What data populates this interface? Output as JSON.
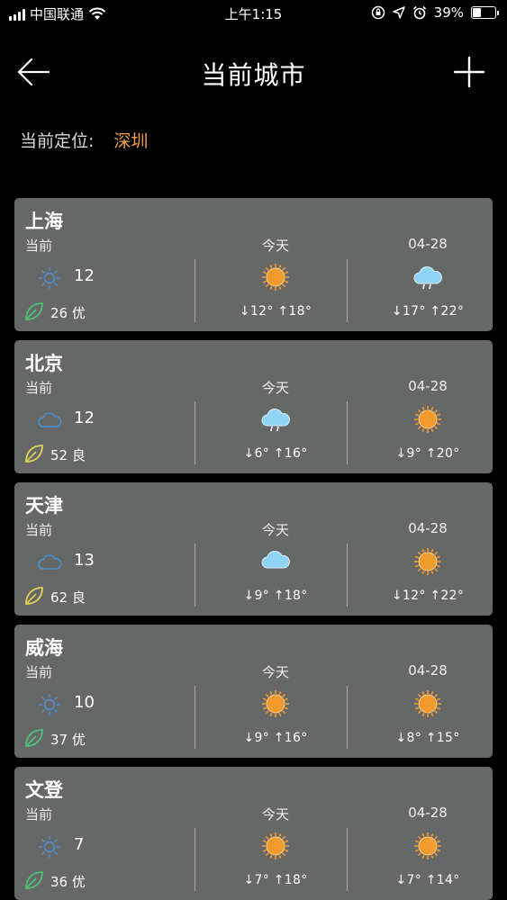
{
  "status_bar": {
    "carrier": "中国联通",
    "time": "上午1:15",
    "battery": "39%",
    "battery_level": 0.39
  },
  "nav": {
    "title": "当前城市",
    "back_icon": "back-arrow-icon",
    "add_icon": "plus-icon"
  },
  "location": {
    "label": "当前定位:",
    "value": "深圳"
  },
  "colors": {
    "background": "#000000",
    "card": "#666767",
    "accent": "#f0a24a",
    "sun": "#f39a2c",
    "cloud_light": "#8fd4f5"
  },
  "cards": [
    {
      "city": "上海",
      "current_label": "当前",
      "current_temp": "12",
      "current_icon": "sun-outline-icon",
      "aqi": "26 优",
      "aqi_color": "#4fc27a",
      "today_label": "今天",
      "today_icon": "sun-icon",
      "today_temps": "↓12° ↑18°",
      "next_label": "04-28",
      "next_icon": "cloud-rain-icon",
      "next_temps": "↓17° ↑22°"
    },
    {
      "city": "北京",
      "current_label": "当前",
      "current_temp": "12",
      "current_icon": "cloud-outline-icon",
      "aqi": "52 良",
      "aqi_color": "#e2d45a",
      "today_label": "今天",
      "today_icon": "cloud-rain-icon",
      "today_temps": "↓6° ↑16°",
      "next_label": "04-28",
      "next_icon": "sun-icon",
      "next_temps": "↓9° ↑20°"
    },
    {
      "city": "天津",
      "current_label": "当前",
      "current_temp": "13",
      "current_icon": "cloud-outline-icon",
      "aqi": "62 良",
      "aqi_color": "#e2d45a",
      "today_label": "今天",
      "today_icon": "cloud-icon",
      "today_temps": "↓9° ↑18°",
      "next_label": "04-28",
      "next_icon": "sun-icon",
      "next_temps": "↓12° ↑22°"
    },
    {
      "city": "威海",
      "current_label": "当前",
      "current_temp": "10",
      "current_icon": "sun-outline-icon",
      "aqi": "37 优",
      "aqi_color": "#4fc27a",
      "today_label": "今天",
      "today_icon": "sun-icon",
      "today_temps": "↓9° ↑16°",
      "next_label": "04-28",
      "next_icon": "sun-icon",
      "next_temps": "↓8° ↑15°"
    },
    {
      "city": "文登",
      "current_label": "当前",
      "current_temp": "7",
      "current_icon": "sun-outline-icon",
      "aqi": "36 优",
      "aqi_color": "#4fc27a",
      "today_label": "今天",
      "today_icon": "sun-icon",
      "today_temps": "↓7° ↑18°",
      "next_label": "04-28",
      "next_icon": "sun-icon",
      "next_temps": "↓7° ↑14°"
    }
  ]
}
